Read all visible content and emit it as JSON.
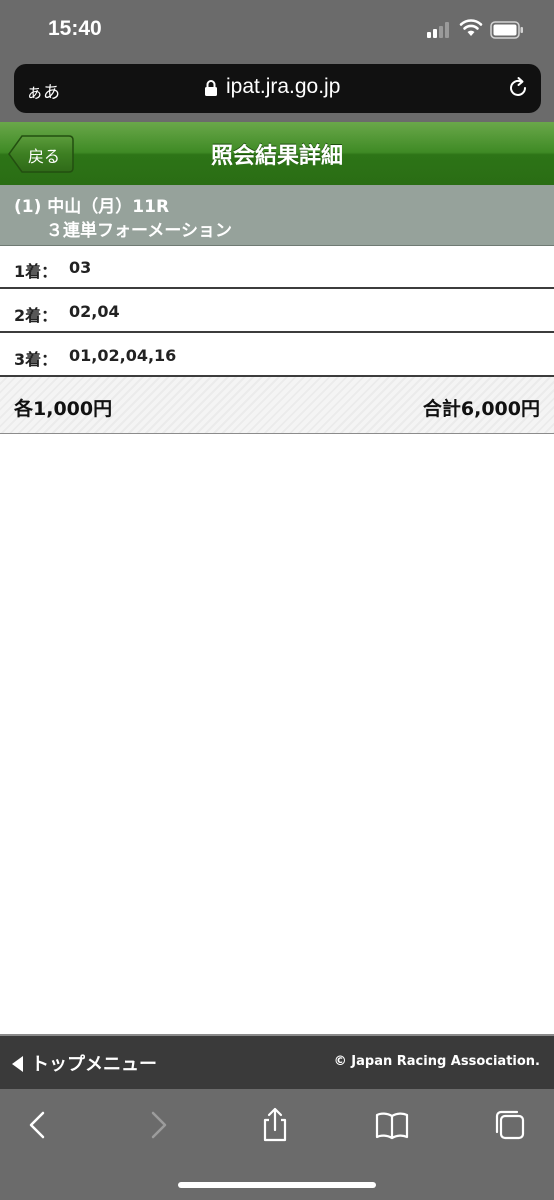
{
  "status_bar": {
    "time": "15:40"
  },
  "url_bar": {
    "text_size_label": "ぁあ",
    "url": "ipat.jra.go.jp"
  },
  "header": {
    "back_label": "戻る",
    "title": "照会結果詳細"
  },
  "race": {
    "line1": "(1) 中山（月）11R",
    "line2": "３連単フォーメーション"
  },
  "places": [
    {
      "label": "1着：",
      "value": "03"
    },
    {
      "label": "2着：",
      "value": "02,04"
    },
    {
      "label": "3着：",
      "value": "01,02,04,16"
    }
  ],
  "totals": {
    "each": "各1,000円",
    "sum": "合計6,000円"
  },
  "footer": {
    "top_menu_label": "トップメニュー",
    "copyright": "© Japan Racing Association."
  },
  "toolbar": {
    "icons": [
      "back-icon",
      "forward-icon",
      "share-icon",
      "bookmarks-icon",
      "tabs-icon"
    ]
  },
  "colors": {
    "header_green": "#3f8a25",
    "race_bar": "#96a29b",
    "footer": "#3a3a3a",
    "browser_chrome": "#6b6b6b"
  }
}
